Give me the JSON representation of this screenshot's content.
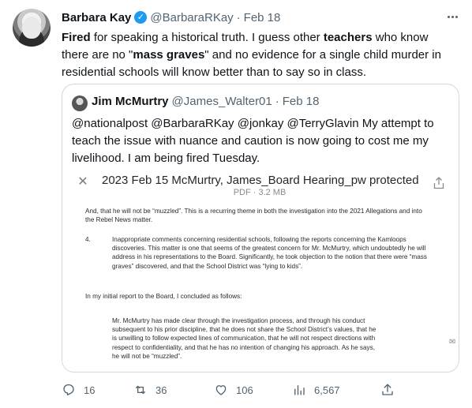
{
  "tweet": {
    "author_name": "Barbara Kay",
    "author_handle": "@BarbaraRKay",
    "date_sep": "·",
    "date": "Feb 18",
    "text_parts": {
      "w1": "Fired",
      "t1": " for speaking a historical truth. I guess other ",
      "w2": "teachers",
      "t2": " who know there are no \"",
      "w3": "mass graves",
      "t3": "\" and no evidence for a single child murder in residential schools will know better than to say so in class."
    },
    "icons": {
      "verified": "verified-badge-icon",
      "more": "more-options-icon"
    }
  },
  "quote": {
    "author_name": "Jim McMurtry",
    "author_handle": "@James_Walter01",
    "date_sep": "·",
    "date": "Feb 18",
    "text": "@nationalpost @BarbaraRKay @jonkay @TerryGlavin My attempt to teach the issue with nuance and caution is now going to cost me my livelihood.  I am being fired Tuesday."
  },
  "document": {
    "close_symbol": "✕",
    "title": "2023 Feb 15 McMurtry, James_Board Hearing_pw protected",
    "subtitle": "PDF · 3.2 MB",
    "para1": "And, that he will not be “muzzled”.  This is a recurring theme in both the investigation into the 2021 Allegations and into the Rebel News matter.",
    "para2_num": "4.",
    "para2": "Inappropriate comments concerning residential schools, following the reports concerning the Kamloops discoveries.  This matter is one that seems of the greatest concern for Mr. McMurtry, which undoubtedly he will address in his representations to the Board.  Significantly, he took objection to the notion that there were “mass graves” discovered, and that the School District was “lying to kids”.",
    "para3": "In my initial report to the Board, I concluded as follows:",
    "para4": "Mr. McMurtry has made clear through the investigation process, and through his conduct subsequent to his prior discipline, that he does not share the School District’s values, that he is unwilling to follow expected lines of communication, that he will not respect directions with respect to confidentiality, and that he has no intention of changing his approach.  As he says, he will not be “muzzled”.",
    "side_icon": "✉"
  },
  "actions": {
    "replies": "16",
    "retweets": "36",
    "likes": "106",
    "views": "6,567"
  },
  "colors": {
    "accent": "#1d9bf0",
    "text": "#0f1419",
    "secondary": "#536471",
    "border": "#cfd9de"
  }
}
